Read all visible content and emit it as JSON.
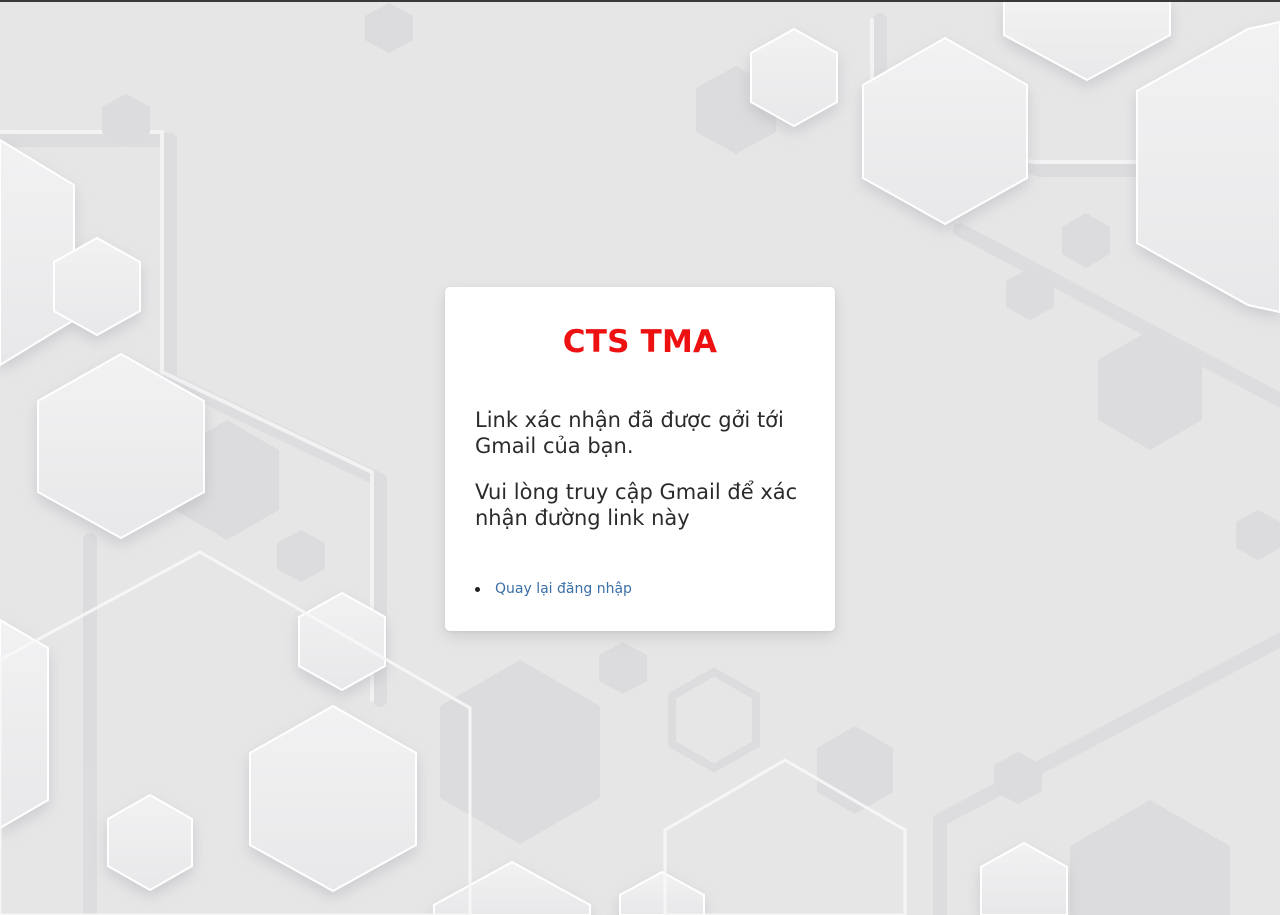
{
  "card": {
    "brand": "CTS TMA",
    "message_sent": "Link xác nhận đã được gởi tới Gmail của bạn.",
    "message_instruction": "Vui lòng truy cập Gmail để xác nhận đường link này",
    "back_to_login_label": "Quay lại đăng nhập"
  },
  "colors": {
    "brand": "#ee1111",
    "link": "#3b6fa8",
    "background": "#e6e6e7",
    "card": "#ffffff"
  },
  "icons": {
    "bullet": "disc-bullet-icon"
  }
}
